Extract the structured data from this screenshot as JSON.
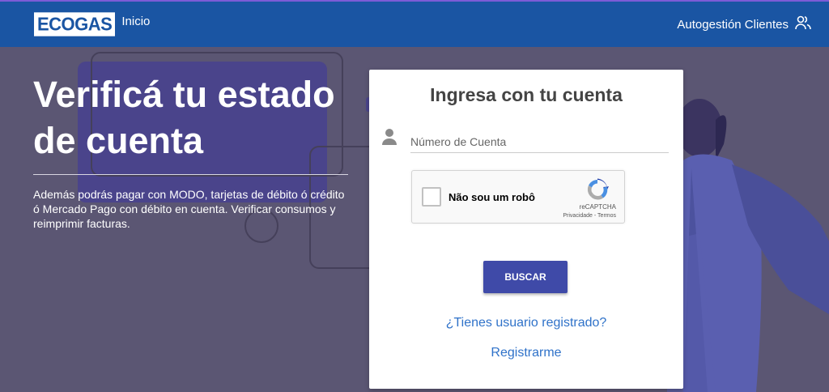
{
  "navbar": {
    "logo_text": "ECOGAS",
    "home_link": "Inicio",
    "self_service": "Autogestión Clientes"
  },
  "hero": {
    "title": "Verificá tu estado de cuenta",
    "subtitle": "Además podrás pagar con MODO, tarjetas de débito ó crédito ó Mercado Pago con débito en cuenta. Verificar consumos y reimprimir facturas."
  },
  "login": {
    "title": "Ingresa con tu cuenta",
    "account_placeholder": "Número de Cuenta",
    "account_value": "",
    "recaptcha": {
      "label": "Não sou um robô",
      "brand": "reCAPTCHA",
      "links": "Privacidade - Termos"
    },
    "search_button": "BUSCAR",
    "registered_link": "¿Tienes usuario registrado?",
    "register_link": "Registrarme"
  },
  "colors": {
    "navbar": "#1a55a3",
    "hero_bg": "#5b5673",
    "button": "#3f4aa8",
    "link": "#2f72c9"
  },
  "icons": {
    "self_service": "users-icon",
    "account": "user-icon",
    "recaptcha": "recaptcha-icon"
  }
}
